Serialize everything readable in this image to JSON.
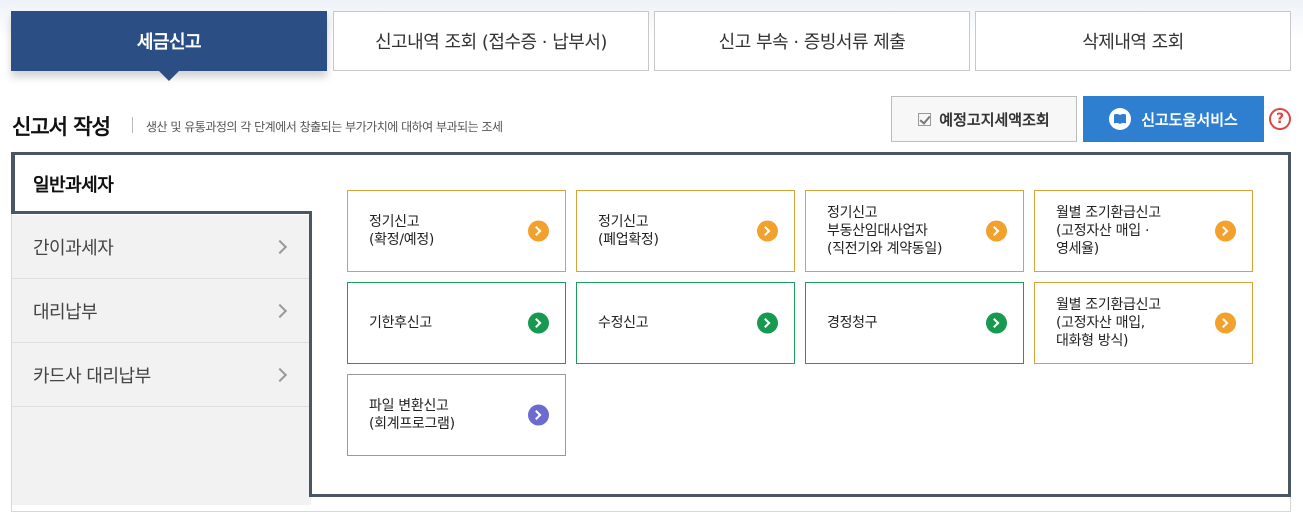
{
  "tabs": [
    {
      "label": "세금신고",
      "active": true
    },
    {
      "label": "신고내역 조회 (접수증 · 납부서)",
      "active": false
    },
    {
      "label": "신고 부속 · 증빙서류 제출",
      "active": false
    },
    {
      "label": "삭제내역 조회",
      "active": false
    }
  ],
  "header": {
    "title": "신고서 작성",
    "description": "생산 및 유통과정의 각 단계에서 창출되는 부가가치에 대하여 부과되는 조세",
    "btn_estimate": "예정고지세액조회",
    "btn_help_service": "신고도움서비스",
    "help_icon": "?"
  },
  "sidebar": {
    "items": [
      {
        "label": "일반과세자",
        "active": true
      },
      {
        "label": "간이과세자",
        "active": false
      },
      {
        "label": "대리납부",
        "active": false
      },
      {
        "label": "카드사 대리납부",
        "active": false
      }
    ]
  },
  "cards": [
    {
      "label": "정기신고\n(확정/예정)",
      "color": "orange"
    },
    {
      "label": "정기신고\n(폐업확정)",
      "color": "orange"
    },
    {
      "label": "정기신고\n부동산임대사업자\n(직전기와 계약동일)",
      "color": "orange"
    },
    {
      "label": "월별 조기환급신고\n(고정자산 매입 ·\n영세율)",
      "color": "orange"
    },
    {
      "label": "기한후신고",
      "color": "green"
    },
    {
      "label": "수정신고",
      "color": "green"
    },
    {
      "label": "경정청구",
      "color": "green"
    },
    {
      "label": "월별 조기환급신고\n(고정자산 매입,\n대화형 방식)",
      "color": "orange"
    },
    {
      "label": "파일 변환신고\n(회계프로그램)",
      "color": "purple"
    }
  ],
  "colors": {
    "active_tab": "#2b4f84",
    "help_service_button": "#2e7fcf",
    "orange": "#f2a12c",
    "green": "#179a4f",
    "purple": "#6b6bd0",
    "help_icon": "#e04545"
  },
  "icons": {
    "estimate_button": "checkbox-icon",
    "help_service_button": "book-icon",
    "card_arrow": "chevron-right-circle-icon",
    "sidebar_arrow": "chevron-right-icon"
  }
}
